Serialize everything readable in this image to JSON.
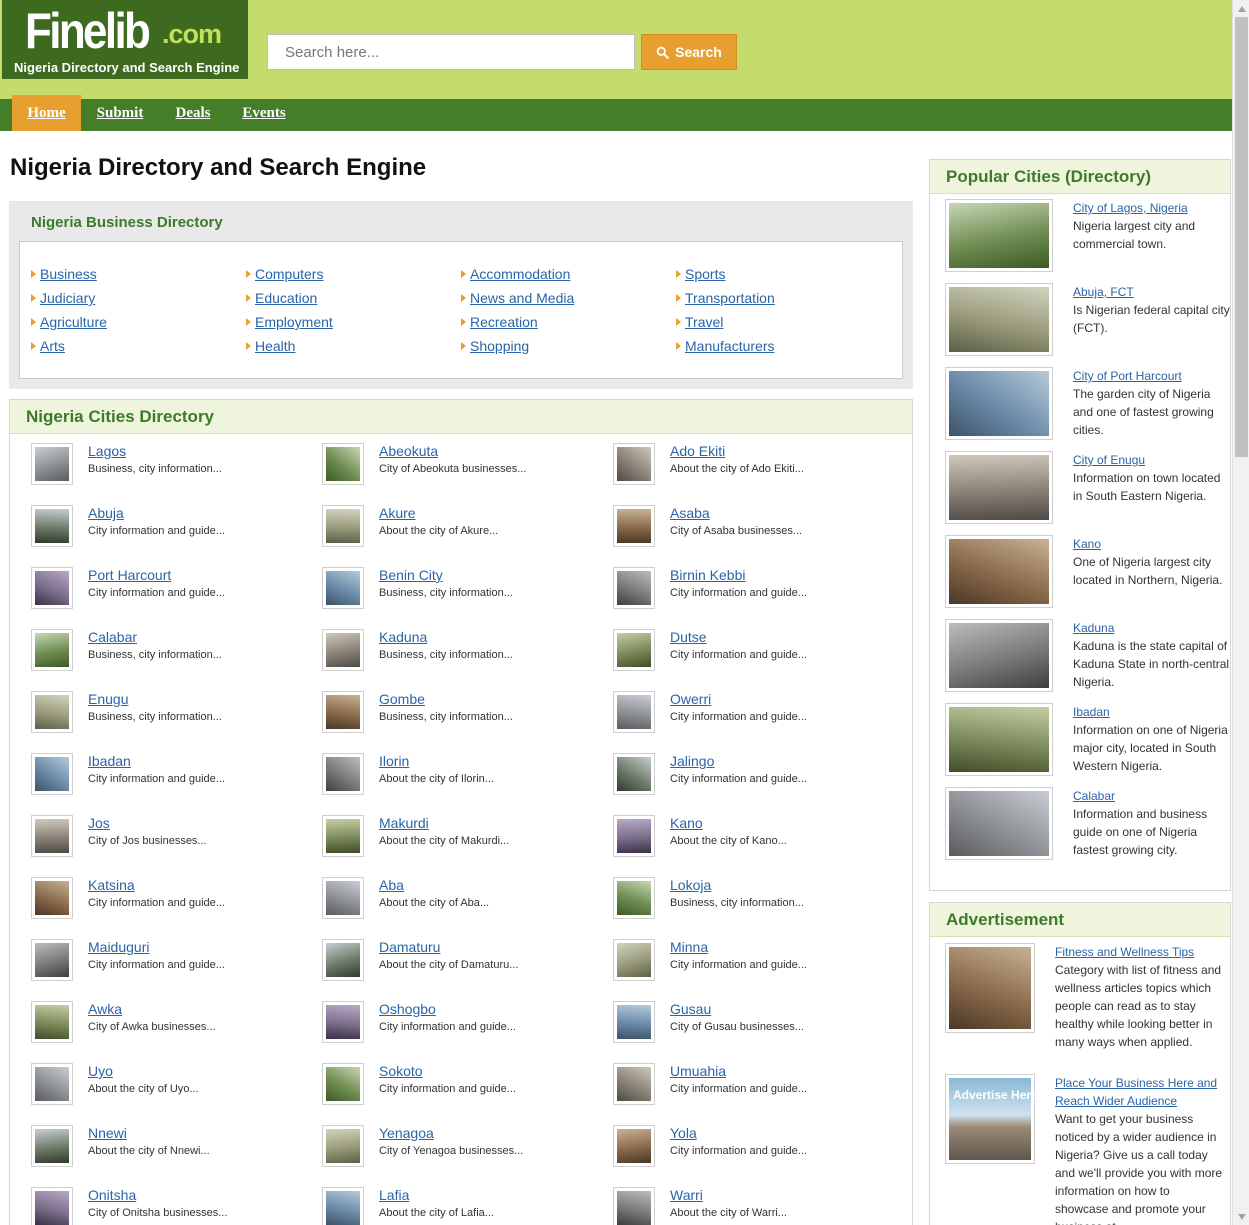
{
  "logo": {
    "name_main": "Finelib",
    "name_suffix": ".com",
    "tagline": "Nigeria Directory and Search Engine"
  },
  "search": {
    "placeholder": "Search here...",
    "button_label": "Search"
  },
  "nav": {
    "items": [
      "Home",
      "Submit",
      "Deals",
      "Events"
    ],
    "active": "Home"
  },
  "page_title": "Nigeria Directory and Search Engine",
  "business_directory": {
    "title": "Nigeria Business Directory",
    "columns": [
      [
        "Business",
        "Judiciary",
        "Agriculture",
        "Arts"
      ],
      [
        "Computers",
        "Education",
        "Employment",
        "Health"
      ],
      [
        "Accommodation",
        "News and Media",
        "Recreation",
        "Shopping"
      ],
      [
        "Sports",
        "Transportation",
        "Travel",
        "Manufacturers"
      ]
    ]
  },
  "cities_directory": {
    "title": "Nigeria Cities Directory",
    "columns": [
      [
        {
          "name": "Lagos",
          "desc": "Business, city information..."
        },
        {
          "name": "Abuja",
          "desc": "City information and guide..."
        },
        {
          "name": "Port Harcourt",
          "desc": "City information and guide..."
        },
        {
          "name": "Calabar",
          "desc": "Business, city information..."
        },
        {
          "name": "Enugu",
          "desc": "Business, city information..."
        },
        {
          "name": "Ibadan",
          "desc": "City information and guide..."
        },
        {
          "name": "Jos",
          "desc": "City of Jos businesses..."
        },
        {
          "name": "Katsina",
          "desc": "City information and guide..."
        },
        {
          "name": "Maiduguri",
          "desc": "City information and guide..."
        },
        {
          "name": "Awka",
          "desc": "City of Awka businesses..."
        },
        {
          "name": "Uyo",
          "desc": "About the city of Uyo..."
        },
        {
          "name": "Nnewi",
          "desc": "About the city of Nnewi..."
        },
        {
          "name": "Onitsha",
          "desc": "City of Onitsha businesses..."
        }
      ],
      [
        {
          "name": "Abeokuta",
          "desc": "City of Abeokuta businesses..."
        },
        {
          "name": "Akure",
          "desc": "About the city of Akure..."
        },
        {
          "name": "Benin City",
          "desc": "Business, city information..."
        },
        {
          "name": "Kaduna",
          "desc": "Business, city information..."
        },
        {
          "name": "Gombe",
          "desc": "Business, city information..."
        },
        {
          "name": "Ilorin",
          "desc": "About the city of Ilorin..."
        },
        {
          "name": "Makurdi",
          "desc": "About the city of Makurdi..."
        },
        {
          "name": "Aba",
          "desc": "About the city of Aba..."
        },
        {
          "name": "Damaturu",
          "desc": "About the city of Damaturu..."
        },
        {
          "name": "Oshogbo",
          "desc": "City information and guide..."
        },
        {
          "name": "Sokoto",
          "desc": "City information and guide..."
        },
        {
          "name": "Yenagoa",
          "desc": "City of Yenagoa businesses..."
        },
        {
          "name": "Lafia",
          "desc": "About the city of Lafia..."
        }
      ],
      [
        {
          "name": "Ado Ekiti",
          "desc": "About the city of Ado Ekiti..."
        },
        {
          "name": "Asaba",
          "desc": "City of Asaba businesses..."
        },
        {
          "name": "Birnin Kebbi",
          "desc": "City information and guide..."
        },
        {
          "name": "Dutse",
          "desc": "City information and guide..."
        },
        {
          "name": "Owerri",
          "desc": "City information and guide..."
        },
        {
          "name": "Jalingo",
          "desc": "City information and guide..."
        },
        {
          "name": "Kano",
          "desc": "About the city of Kano..."
        },
        {
          "name": "Lokoja",
          "desc": "Business, city information..."
        },
        {
          "name": "Minna",
          "desc": "City information and guide..."
        },
        {
          "name": "Gusau",
          "desc": "City of Gusau businesses..."
        },
        {
          "name": "Umuahia",
          "desc": "City information and guide..."
        },
        {
          "name": "Yola",
          "desc": "City information and guide..."
        },
        {
          "name": "Warri",
          "desc": "About the city of Warri..."
        }
      ]
    ]
  },
  "popular_cities": {
    "title": "Popular Cities (Directory)",
    "items": [
      {
        "name": "City of Lagos, Nigeria",
        "desc": "Nigeria largest city and commercial town."
      },
      {
        "name": "Abuja, FCT",
        "desc": "Is Nigerian federal capital city (FCT)."
      },
      {
        "name": "City of Port Harcourt",
        "desc": "The garden city of Nigeria and one of fastest growing cities."
      },
      {
        "name": "City of Enugu",
        "desc": "Information on town located in South Eastern Nigeria."
      },
      {
        "name": "Kano",
        "desc": "One of Nigeria largest city located in Northern, Nigeria."
      },
      {
        "name": "Kaduna",
        "desc": "Kaduna is the state capital of Kaduna State in north-central Nigeria."
      },
      {
        "name": "Ibadan",
        "desc": "Information on one of Nigeria major city, located in South Western Nigeria."
      },
      {
        "name": "Calabar",
        "desc": "Information and business guide on one of Nigeria fastest growing city."
      }
    ]
  },
  "advertisement": {
    "title": "Advertisement",
    "items": [
      {
        "name": "Fitness and Wellness Tips",
        "desc": "Category with list of fitness and wellness articles topics which people can read as to stay healthy while looking better in many ways when applied."
      },
      {
        "name": "Place Your Business Here and Reach Wider Audience",
        "desc": "Want to get your business noticed by a wider audience in Nigeria? Give us a call today and we'll provide you with more information on how to showcase and promote your business at"
      }
    ],
    "banner_text": "Advertise Here."
  },
  "colors": {
    "header_bg": "#c3dc6c",
    "logo_bg": "#3e6a1f",
    "nav_bg": "#457e28",
    "accent_orange": "#e7a02f",
    "section_title_green": "#3d7a2a",
    "link_blue": "#2a64a8"
  }
}
